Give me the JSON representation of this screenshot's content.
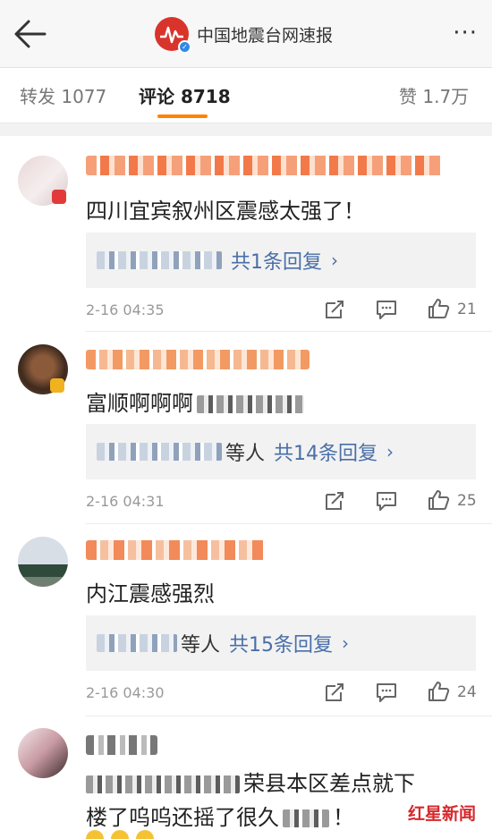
{
  "header": {
    "back_icon": "arrow-left-icon",
    "account_name": "中国地震台网速报",
    "more_icon": "more-dots-icon",
    "more_glyph": "···"
  },
  "tabs": [
    {
      "label": "转发 1077",
      "active": false
    },
    {
      "label": "评论 8718",
      "active": true
    },
    {
      "label": "赞 1.7万",
      "active": false
    }
  ],
  "accent_color": "#ff8200",
  "link_color": "#496fa8",
  "comments": [
    {
      "text": "四川宜宾叙州区震感太强了！",
      "reply_prefix_users": "",
      "reply_count": "共1条回复",
      "chevron": "›",
      "time": "2-16 04:35",
      "likes": "21"
    },
    {
      "text": "富顺啊啊啊",
      "reply_prefix_users": "等人",
      "reply_count": "共14条回复",
      "chevron": "›",
      "time": "2-16 04:31",
      "likes": "25"
    },
    {
      "text": "内江震感强烈",
      "reply_prefix_users": "等人",
      "reply_count": "共15条回复",
      "chevron": "›",
      "time": "2-16 04:30",
      "likes": "24"
    },
    {
      "text_line1": "荣县本区差点就下",
      "text_line2_a": "楼了呜呜还摇了很久",
      "text_line2_b": "！"
    }
  ],
  "watermark": "红星新闻"
}
